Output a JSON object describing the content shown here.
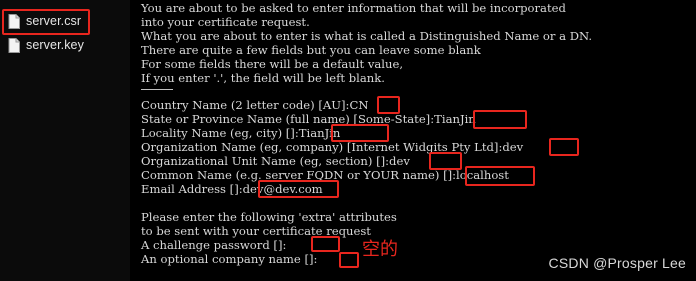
{
  "explorer": {
    "files": [
      {
        "name": "server.csr",
        "icon": "document-icon"
      },
      {
        "name": "server.key",
        "icon": "document-icon"
      }
    ]
  },
  "terminal": {
    "intro": [
      "You are about to be asked to enter information that will be incorporated",
      "into your certificate request.",
      "What you are about to enter is what is called a Distinguished Name or a DN.",
      "There are quite a few fields but you can leave some blank",
      "For some fields there will be a default value,",
      "If you enter '.', the field will be left blank."
    ],
    "dash": "-----",
    "fields": [
      {
        "prompt": "Country Name (2 letter code) [AU]:",
        "value": "CN"
      },
      {
        "prompt": "State or Province Name (full name) [Some-State]:",
        "value": "TianJin"
      },
      {
        "prompt": "Locality Name (eg, city) []:",
        "value": "TianJin"
      },
      {
        "prompt": "Organization Name (eg, company) [Internet Widgits Pty Ltd]:",
        "value": "dev"
      },
      {
        "prompt": "Organizational Unit Name (eg, section) []:",
        "value": "dev"
      },
      {
        "prompt": "Common Name (e.g. server FQDN or YOUR name) []:",
        "value": "localhost"
      },
      {
        "prompt": "Email Address []:",
        "value": "dev@dev.com"
      }
    ],
    "extra_intro": [
      "Please enter the following 'extra' attributes",
      "to be sent with your certificate request"
    ],
    "extra_fields": [
      {
        "prompt": "A challenge password []:",
        "value": ""
      },
      {
        "prompt": "An optional company name []:",
        "value": ""
      }
    ]
  },
  "annotation": "空的",
  "watermark": "CSDN @Prosper Lee",
  "colors": {
    "highlight": "#e8261e",
    "terminal_bg": "#000000",
    "terminal_text": "#d9d9d9"
  }
}
